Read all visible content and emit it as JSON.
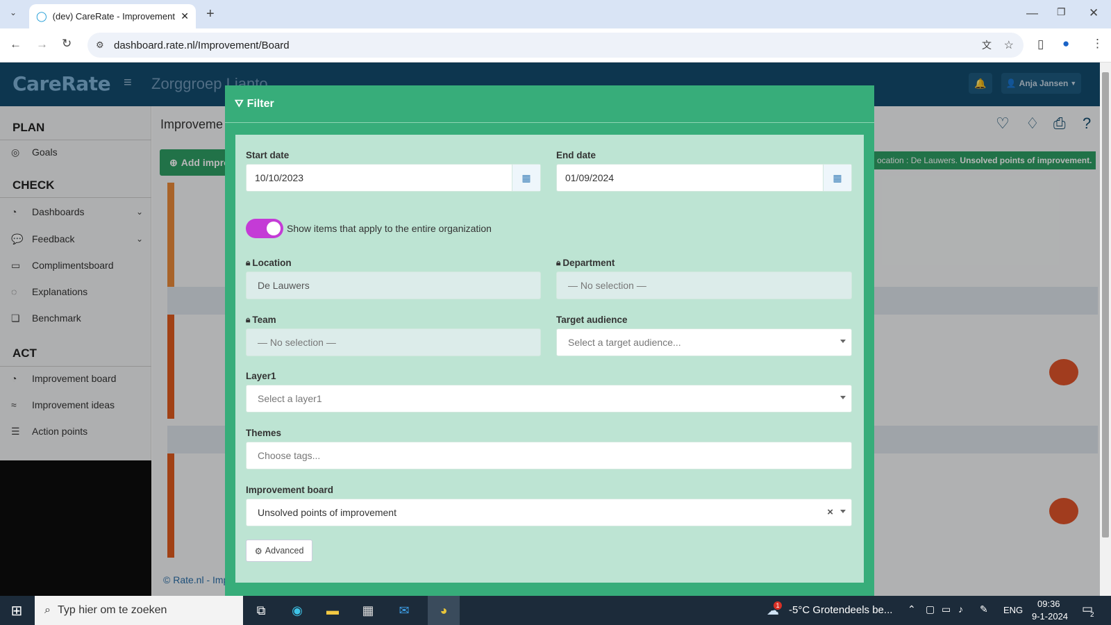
{
  "browser": {
    "tab_title": "(dev) CareRate - Improvement",
    "url": "dashboard.rate.nl/Improvement/Board"
  },
  "app": {
    "brand": "CareRate",
    "org": "Zorggroep Lianto",
    "user": "Anja Jansen",
    "page_title": "Improveme",
    "add_button": "Add impro",
    "filter_banner_label": "ocation : De Lauwers.",
    "filter_banner_bold": "Unsolved points of improvement.",
    "footer": "© Rate.nl - Imp"
  },
  "sidebar": {
    "plan": "PLAN",
    "check": "CHECK",
    "act": "ACT",
    "items": [
      {
        "label": "Goals",
        "icon": "target-icon"
      },
      {
        "label": "Dashboards",
        "icon": "gauge-icon"
      },
      {
        "label": "Feedback",
        "icon": "chat-icon"
      },
      {
        "label": "Complimentsboard",
        "icon": "message-square-icon"
      },
      {
        "label": "Explanations",
        "icon": "comment-icon"
      },
      {
        "label": "Benchmark",
        "icon": "copy-icon"
      },
      {
        "label": "Improvement board",
        "icon": "gauge-icon"
      },
      {
        "label": "Improvement ideas",
        "icon": "trend-icon"
      },
      {
        "label": "Action points",
        "icon": "list-icon"
      }
    ]
  },
  "modal": {
    "title": "Filter",
    "start_date_label": "Start date",
    "start_date": "10/10/2023",
    "end_date_label": "End date",
    "end_date": "01/09/2024",
    "toggle_label": "Show items that apply to the entire organization",
    "location_label": "Location",
    "location_value": "De Lauwers",
    "department_label": "Department",
    "department_value": "— No selection —",
    "team_label": "Team",
    "team_value": "— No selection —",
    "target_label": "Target audience",
    "target_placeholder": "Select a target audience...",
    "layer1_label": "Layer1",
    "layer1_placeholder": "Select a layer1",
    "themes_label": "Themes",
    "themes_placeholder": "Choose tags...",
    "board_label": "Improvement board",
    "board_value": "Unsolved points of improvement",
    "advanced": "Advanced"
  },
  "taskbar": {
    "search_placeholder": "Typ hier om te zoeken",
    "weather": "-5°C  Grotendeels be...",
    "weather_badge": "1",
    "lang": "ENG",
    "time": "09:36",
    "date": "9-1-2024",
    "notif_count": "2"
  },
  "colors": {
    "header": "#134b6e",
    "modal": "#37ad7a",
    "modal_body": "#bde4d3",
    "toggle": "#c43bd6"
  }
}
